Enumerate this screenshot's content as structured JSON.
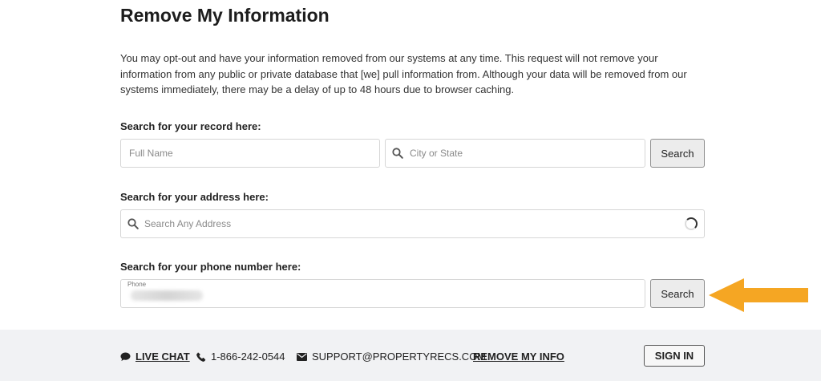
{
  "page": {
    "title": "Remove My Information",
    "intro": "You may opt-out and have your information removed from our systems at any time. This request will not remove your information from any public or private database that [we] pull information from. Although your data will be removed from our systems immediately, there may be a delay of up to 48 hours due to browser caching."
  },
  "record_search": {
    "label": "Search for your record here:",
    "name_placeholder": "Full Name",
    "location_placeholder": "City or State",
    "button_label": "Search"
  },
  "address_search": {
    "label": "Search for your address here:",
    "placeholder": "Search Any Address"
  },
  "phone_search": {
    "label": "Search for your phone number here:",
    "field_label": "Phone",
    "button_label": "Search"
  },
  "footer": {
    "live_chat": "LIVE CHAT",
    "phone": "1-866-242-0544",
    "email": "SUPPORT@PROPERTYRECS.COM",
    "remove_info": "REMOVE MY INFO",
    "sign_in": "SIGN IN"
  },
  "colors": {
    "arrow": "#f5a623",
    "footer_bg": "#f1f2f4",
    "button_bg": "#ececec"
  },
  "icons": {
    "search": "search-icon",
    "spinner": "loading-spinner-icon",
    "chat": "chat-bubble-icon",
    "phone": "phone-icon",
    "email": "envelope-icon",
    "arrow": "arrow-left-icon"
  }
}
